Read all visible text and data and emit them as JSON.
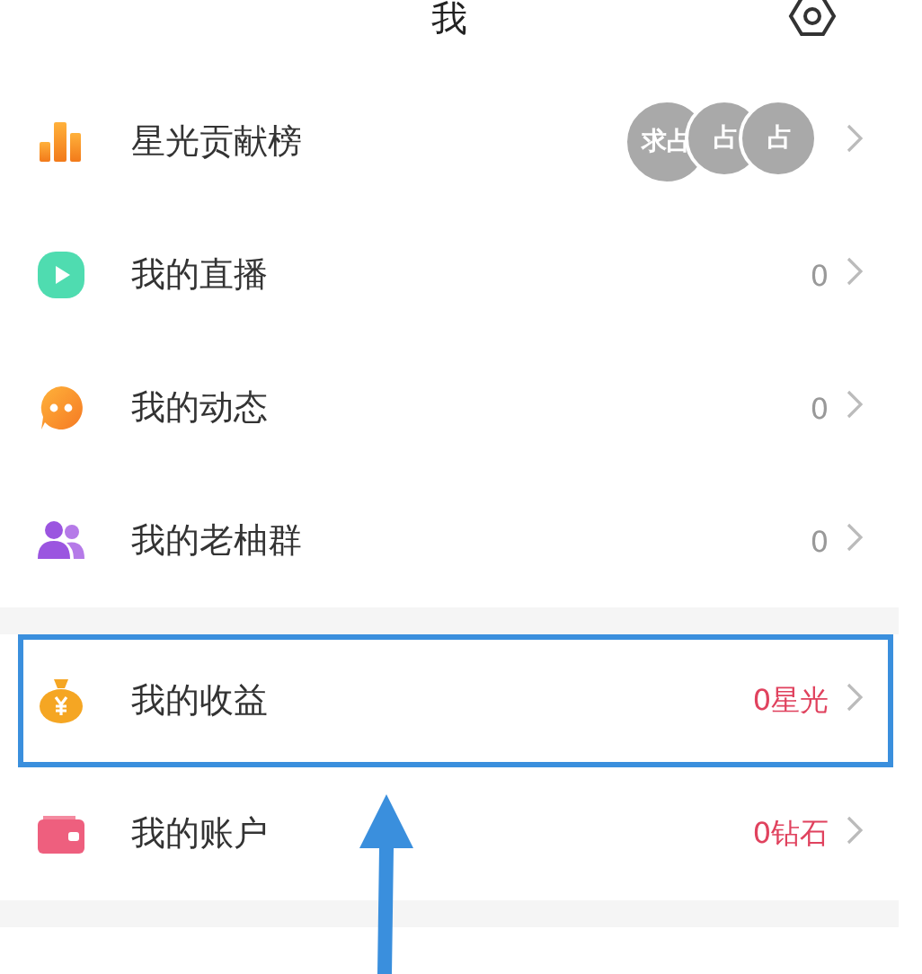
{
  "header": {
    "title": "我"
  },
  "sections": [
    {
      "rows": [
        {
          "kind": "ranking",
          "label": "星光贡献榜",
          "avatars": [
            "求占",
            "占",
            "占"
          ],
          "highlighted": false
        },
        {
          "kind": "count",
          "label": "我的直播",
          "value": "0",
          "highlighted": false
        },
        {
          "kind": "count",
          "label": "我的动态",
          "value": "0",
          "highlighted": false
        },
        {
          "kind": "count",
          "label": "我的老柚群",
          "value": "0",
          "highlighted": false
        }
      ]
    },
    {
      "rows": [
        {
          "kind": "balance",
          "label": "我的收益",
          "value": "0星光",
          "highlighted": true
        },
        {
          "kind": "balance",
          "label": "我的账户",
          "value": "0钻石",
          "highlighted": false
        }
      ]
    }
  ]
}
